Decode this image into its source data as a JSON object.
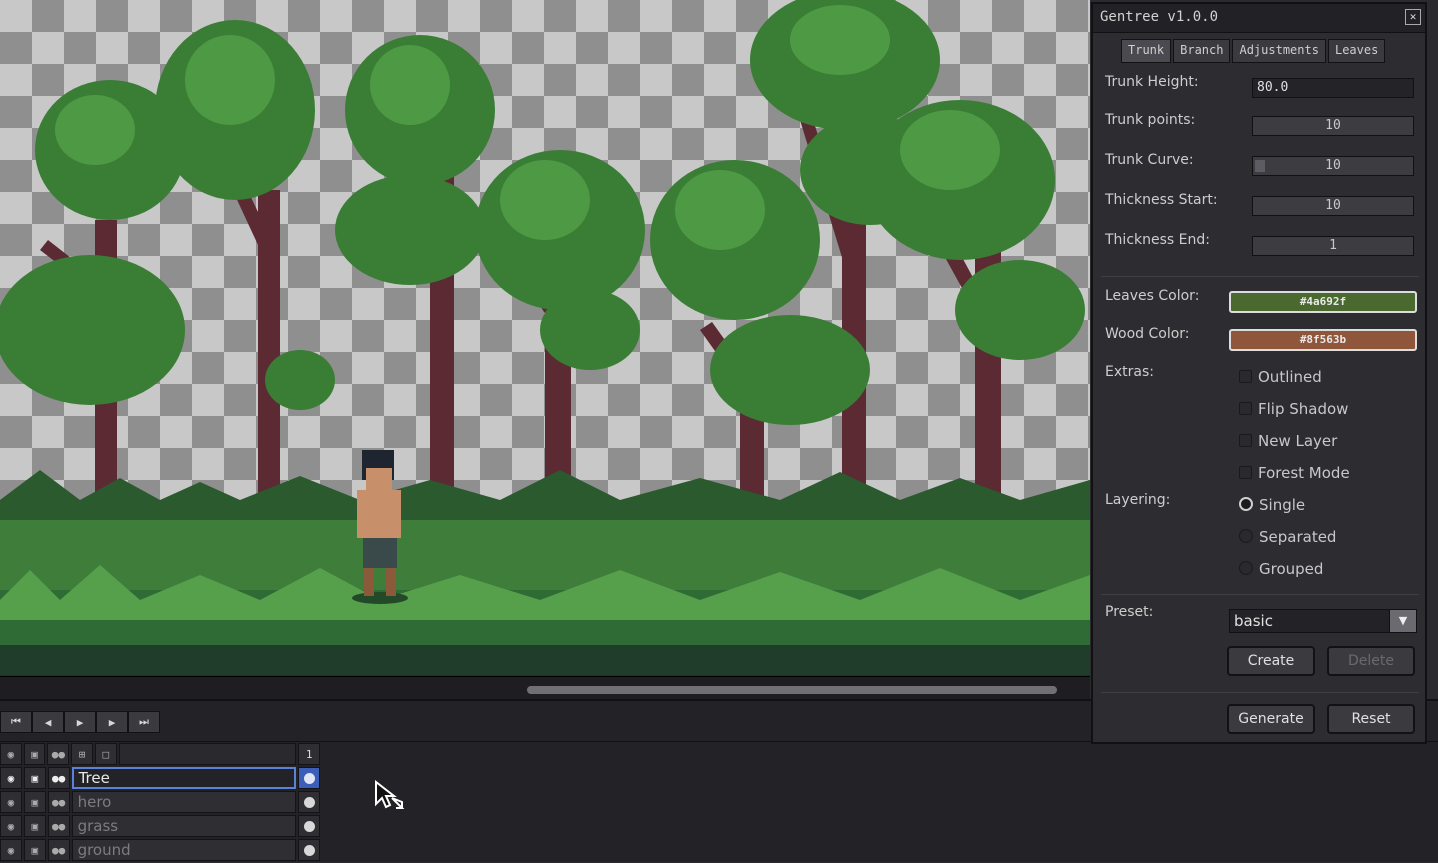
{
  "panel": {
    "title": "Gentree v1.0.0",
    "close_icon": "close-icon",
    "tabs": [
      "Trunk",
      "Branch",
      "Adjustments",
      "Leaves"
    ],
    "trunk_height": {
      "label": "Trunk Height:",
      "value": "80.0"
    },
    "trunk_points": {
      "label": "Trunk points:",
      "value": "10"
    },
    "trunk_curve": {
      "label": "Trunk Curve:",
      "value": "10"
    },
    "thickness_start": {
      "label": "Thickness Start:",
      "value": "10"
    },
    "thickness_end": {
      "label": "Thickness End:",
      "value": "1"
    },
    "leaves_color": {
      "label": "Leaves Color:",
      "value": "#4a692f",
      "color": "#4a692f"
    },
    "wood_color": {
      "label": "Wood Color:",
      "value": "#8f563b",
      "color": "#8f563b"
    },
    "extras": {
      "label": "Extras:",
      "options": [
        "Outlined",
        "Flip Shadow",
        "New Layer",
        "Forest Mode"
      ]
    },
    "layering": {
      "label": "Layering:",
      "options": [
        "Single",
        "Separated",
        "Grouped"
      ],
      "selected": "Single"
    },
    "preset": {
      "label": "Preset:",
      "value": "basic"
    },
    "buttons": {
      "create": "Create",
      "delete": "Delete",
      "generate": "Generate",
      "reset": "Reset"
    }
  },
  "timeline": {
    "frame_number": "1",
    "layers": [
      {
        "name": "Tree",
        "active": true
      },
      {
        "name": "hero",
        "active": false
      },
      {
        "name": "grass",
        "active": false
      },
      {
        "name": "ground",
        "active": false
      }
    ]
  },
  "colors": {
    "grass": "#3f7d3a",
    "trunk": "#5b2a32",
    "accent": "#5a82d8"
  }
}
